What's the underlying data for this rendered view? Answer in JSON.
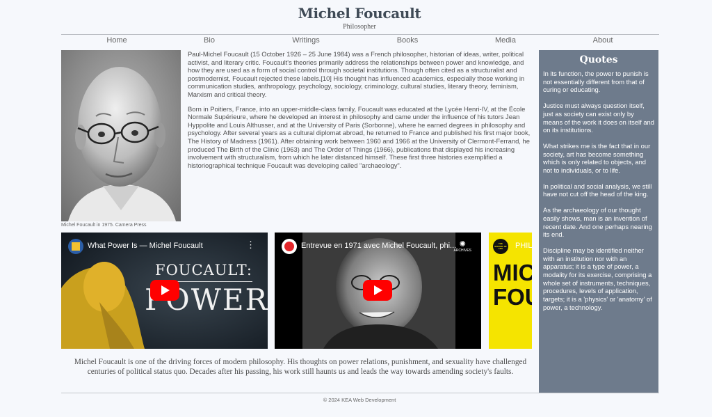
{
  "site": {
    "title": "Michel Foucault",
    "subtitle": "Philosopher"
  },
  "nav": [
    "Home",
    "Bio",
    "Writings",
    "Books",
    "Media",
    "About"
  ],
  "portrait": {
    "caption": "Michel Foucault in 1975. Camera Press"
  },
  "bio": [
    "Paul-Michel Foucault (15 October 1926 – 25 June 1984) was a French philosopher, historian of ideas, writer, political activist, and literary critic. Foucault's theories primarily address the relationships between power and knowledge, and how they are used as a form of social control through societal institutions. Though often cited as a structuralist and postmodernist, Foucault rejected these labels.[10] His thought has influenced academics, especially those working in communication studies, anthropology, psychology, sociology, criminology, cultural studies, literary theory, feminism, Marxism and critical theory.",
    "Born in Poitiers, France, into an upper-middle-class family, Foucault was educated at the Lycée Henri-IV, at the École Normale Supérieure, where he developed an interest in philosophy and came under the influence of his tutors Jean Hyppolite and Louis Althusser, and at the University of Paris (Sorbonne), where he earned degrees in philosophy and psychology. After several years as a cultural diplomat abroad, he returned to France and published his first major book, The History of Madness (1961). After obtaining work between 1960 and 1966 at the University of Clermont-Ferrand, he produced The Birth of the Clinic (1963) and The Order of Things (1966), publications that displayed his increasing involvement with structuralism, from which he later distanced himself. These first three histories exemplified a historiographical technique Foucault was developing called \"archaeology\"."
  ],
  "videos": [
    {
      "title": "What Power Is — Michel Foucault",
      "thumb_line1": "FOUCAULT:",
      "thumb_line2": "POWER"
    },
    {
      "title": "Entrevue en 1971 avec Michel Foucault, phi...",
      "badge": "ARCHIVES"
    },
    {
      "title": "PHIL",
      "thumb_text": "MICH FOUC",
      "channel": "THE SCHOOL OF LIFE"
    }
  ],
  "closing": "Michel Foucault is one of the driving forces of modern philosophy. His thoughts on power relations, punishment, and sexuality have challenged centuries of political status quo. Decades after his passing, his work still haunts us and leads the way towards amending society's faults.",
  "quotes": {
    "title": "Quotes",
    "items": [
      "In its function, the power to punish is not essentially different from that of curing or educating.",
      "Justice must always question itself, just as society can exist only by means of the work it does on itself and on its institutions.",
      "What strikes me is the fact that in our society, art has become something which is only related to objects, and not to individuals, or to life.",
      "In political and social analysis, we still have not cut off the head of the king.",
      "As the archaeology of our thought easily shows, man is an invention of recent date. And one perhaps nearing its end.",
      "Discipline may be identified neither with an institution nor with an apparatus; it is a type of power, a modality for its exercise, comprising a whole set of instruments, techniques, procedures, levels of application, targets; it is a 'physics' or 'anatomy' of power, a technology."
    ]
  },
  "footer": "© 2024 KEA Web Development",
  "colors": {
    "sidebar": "#6e7b8c",
    "title": "#3f4a56",
    "play_button": "#ff0000"
  }
}
